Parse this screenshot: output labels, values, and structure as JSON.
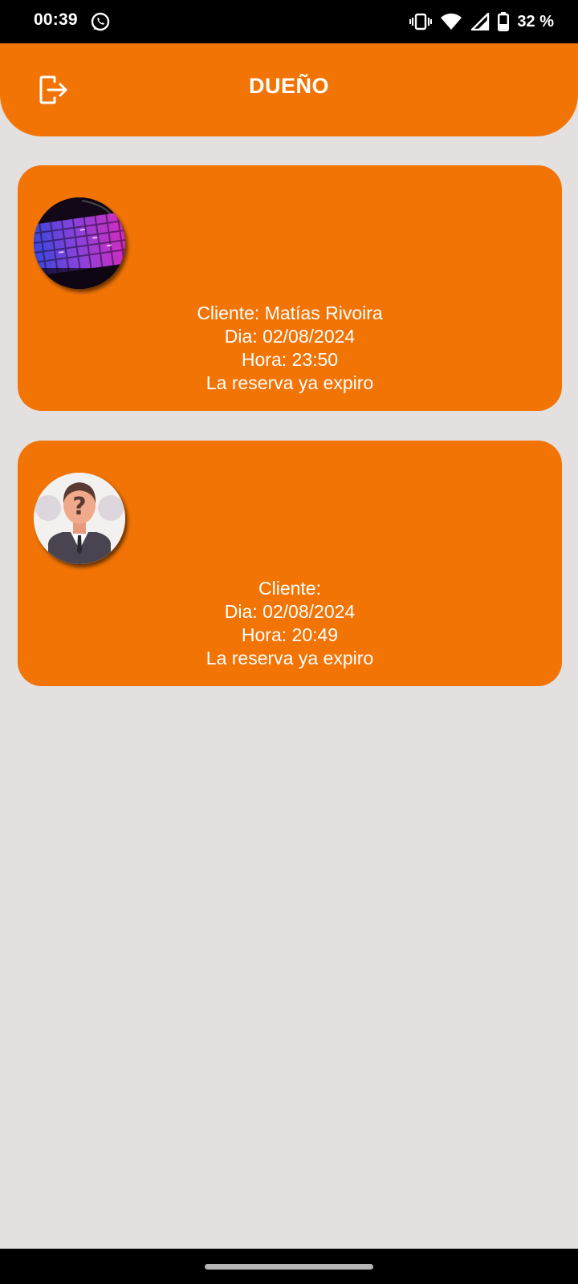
{
  "status_bar": {
    "time": "00:39",
    "notification_icon": "whatsapp-icon",
    "battery": "32 %",
    "icons": [
      "vibrate-icon",
      "wifi-icon",
      "signal-icon",
      "battery-icon"
    ]
  },
  "app_bar": {
    "title": "DUEÑO",
    "logout_icon": "logout-icon"
  },
  "reservations": [
    {
      "avatar": "keyboard-photo",
      "cliente": "Cliente: Matías Rivoira",
      "dia": "Dia: 02/08/2024",
      "hora": "Hora: 23:50",
      "estado": "La reserva ya expiro"
    },
    {
      "avatar": "unknown-person-avatar",
      "cliente": "Cliente:",
      "dia": "Dia: 02/08/2024",
      "hora": "Hora: 20:49",
      "estado": "La reserva ya expiro"
    }
  ],
  "colors": {
    "primary": "#f27405",
    "background": "#e3e0df",
    "text_on_primary": "#ffffff"
  }
}
